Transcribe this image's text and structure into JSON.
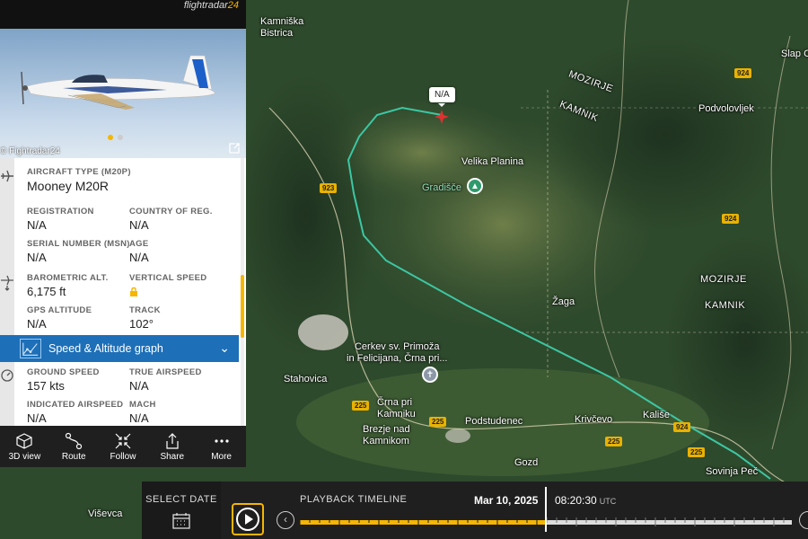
{
  "app": {
    "logo_prefix": "flightradar",
    "logo_suffix": "24",
    "photo_credit": "© Fightradar24"
  },
  "aircraft": {
    "type_label": "AIRCRAFT TYPE (M20P)",
    "type_value": "Mooney M20R",
    "registration_label": "REGISTRATION",
    "registration_value": "N/A",
    "country_label": "COUNTRY OF REG.",
    "country_value": "N/A",
    "serial_label": "SERIAL NUMBER (MSN)",
    "serial_value": "N/A",
    "age_label": "AGE",
    "age_value": "N/A",
    "baro_label": "BAROMETRIC ALT.",
    "baro_value": "6,175 ft",
    "vspeed_label": "VERTICAL SPEED",
    "gps_label": "GPS ALTITUDE",
    "gps_value": "N/A",
    "track_label": "TRACK",
    "track_value": "102°",
    "graph_label": "Speed & Altitude graph",
    "ground_speed_label": "GROUND SPEED",
    "ground_speed_value": "157 kts",
    "true_airspeed_label": "TRUE AIRSPEED",
    "true_airspeed_value": "N/A",
    "indicated_label": "INDICATED AIRSPEED",
    "indicated_value": "N/A",
    "mach_label": "MACH",
    "mach_value": "N/A"
  },
  "toolbar": {
    "view3d": "3D view",
    "route": "Route",
    "follow": "Follow",
    "share": "Share",
    "more": "More"
  },
  "map": {
    "places": {
      "kamniska_bistrica": "Kamniška\nBistrica",
      "mozirje_1": "MOZIRJE",
      "kamnik_1": "KAMNIK",
      "podvolovljek": "Podvolovljek",
      "slap": "Slap C",
      "velika_planina": "Velika Planina",
      "gradisce": "Gradišče",
      "mozirje_2": "MOZIRJE",
      "kamnik_2": "KAMNIK",
      "zaga": "Žaga",
      "cerkev": "Cerkev sv. Primoža\nin Felicijana, Črna pri...",
      "stahovica": "Stahovica",
      "crna": "Črna pri\nKamniku",
      "brezje": "Brezje nad\nKamnikom",
      "podstudenec": "Podstudenec",
      "krivcevo": "Krivčevo",
      "kalise": "Kališe",
      "gozd": "Gozd",
      "sovinja": "Sovinja Peč",
      "visevca": "Viševca",
      "callout": "N/A"
    },
    "roads": {
      "r924a": "924",
      "r923": "923",
      "r924b": "924",
      "r225a": "225",
      "r225b": "225",
      "r225c": "225",
      "r924c": "924",
      "r225d": "225"
    },
    "track_color": "#3cc7a4"
  },
  "playback": {
    "select_date": "SELECT DATE",
    "title": "PLAYBACK TIMELINE",
    "date": "Mar 10, 2025",
    "time": "08:20:30",
    "tz": "UTC",
    "progress_percent": 50
  }
}
